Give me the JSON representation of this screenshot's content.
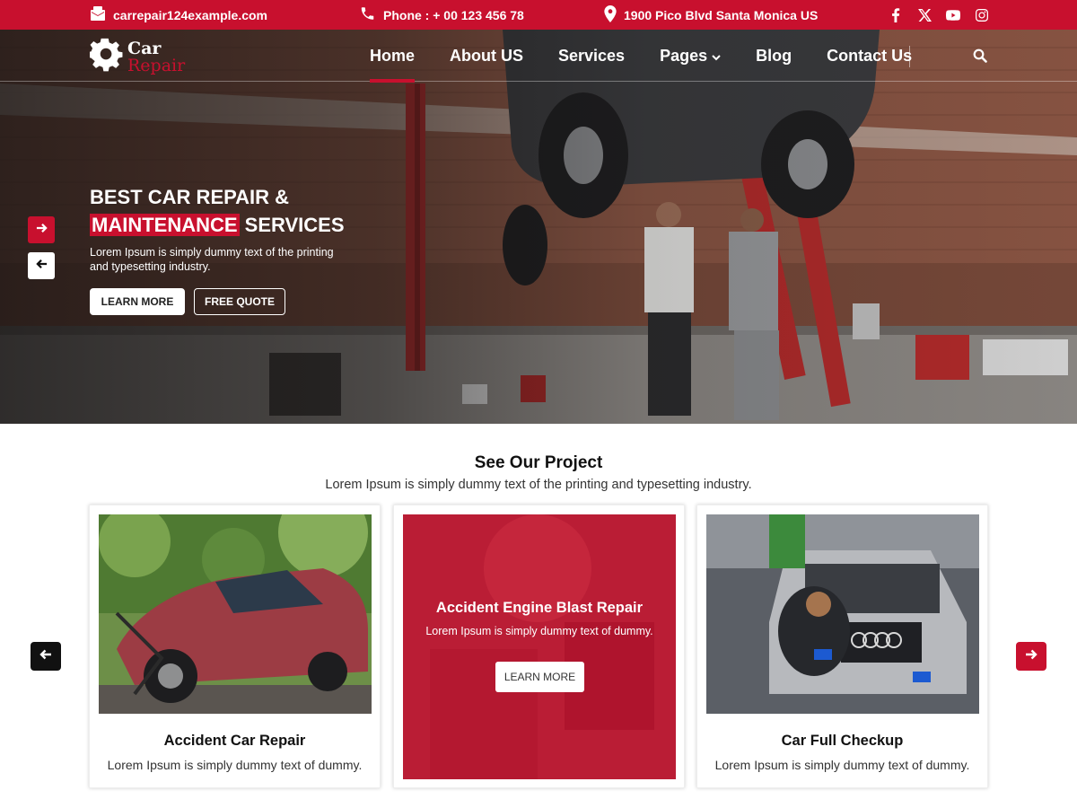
{
  "topbar": {
    "email": "carrepair124example.com",
    "phone": "Phone : + 00 123 456 78",
    "address": "1900 Pico Blvd Santa Monica US",
    "socials": [
      "facebook-icon",
      "x-twitter-icon",
      "youtube-icon",
      "instagram-icon"
    ],
    "bg_color": "#c8102e"
  },
  "logo": {
    "line1": "Car",
    "line2": "Repair"
  },
  "nav": {
    "items": [
      {
        "label": "Home",
        "active": true
      },
      {
        "label": "About US"
      },
      {
        "label": "Services"
      },
      {
        "label": "Pages",
        "has_dropdown": true
      },
      {
        "label": "Blog"
      },
      {
        "label": "Contact Us"
      }
    ]
  },
  "hero": {
    "title_line1": "BEST CAR REPAIR &",
    "title_highlight": "MAINTENANCE",
    "title_rest": " SERVICES",
    "description": "Lorem Ipsum is simply dummy text of the printing and typesetting industry.",
    "learn_more": "LEARN MORE",
    "free_quote": "FREE QUOTE"
  },
  "projects": {
    "title": "See Our Project",
    "subtitle": "Lorem Ipsum is simply dummy text of the printing and typesetting industry.",
    "cards": [
      {
        "title": "Accident Car Repair",
        "desc": "Lorem Ipsum is simply dummy text of dummy."
      },
      {
        "title": "Accident Engine Blast Repair",
        "desc": "Lorem Ipsum is simply dummy text of dummy.",
        "button": "LEARN MORE"
      },
      {
        "title": "Car Full Checkup",
        "desc": "Lorem Ipsum is simply dummy text of dummy."
      }
    ]
  },
  "colors": {
    "accent": "#c8102e",
    "dark": "#111111"
  }
}
